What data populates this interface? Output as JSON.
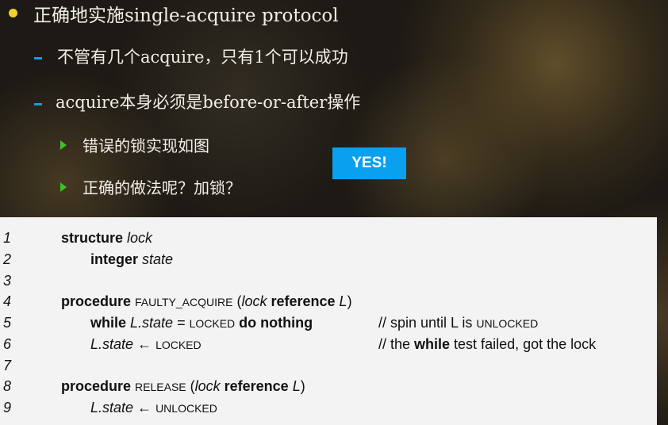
{
  "slide": {
    "bullets": [
      {
        "level": 1,
        "text": "正确地实施single-acquire protocol"
      },
      {
        "level": 2,
        "text": "不管有几个acquire，只有1个可以成功"
      },
      {
        "level": 2,
        "text": "acquire本身必须是before-or-after操作"
      },
      {
        "level": 3,
        "text": "错误的锁实现如图"
      },
      {
        "level": 3,
        "text": "正确的做法呢？加锁？"
      }
    ],
    "yes_label": "YES!",
    "colors": {
      "yes_bg": "#0aa0f0",
      "bullet_dot": "#f2d22a",
      "dash": "#1a9ae0",
      "triangle": "#3fc02a"
    }
  },
  "code": {
    "lines": [
      {
        "num": "1",
        "indent": 1,
        "code": [
          {
            "t": "structure ",
            "s": "b"
          },
          {
            "t": "lock",
            "s": "i"
          }
        ],
        "comment": []
      },
      {
        "num": "2",
        "indent": 2,
        "code": [
          {
            "t": "integer ",
            "s": "b"
          },
          {
            "t": "state",
            "s": "i"
          }
        ],
        "comment": []
      },
      {
        "num": "3",
        "indent": 1,
        "code": [],
        "comment": []
      },
      {
        "num": "4",
        "indent": 1,
        "code": [
          {
            "t": "procedure ",
            "s": "b"
          },
          {
            "t": "FAULTY_ACQUIRE",
            "s": "sc"
          },
          {
            "t": " (",
            "s": "n"
          },
          {
            "t": "lock",
            "s": "i"
          },
          {
            "t": " reference ",
            "s": "b"
          },
          {
            "t": "L",
            "s": "i"
          },
          {
            "t": ")",
            "s": "n"
          }
        ],
        "comment": []
      },
      {
        "num": "5",
        "indent": 2,
        "code": [
          {
            "t": "while ",
            "s": "b"
          },
          {
            "t": "L.state",
            "s": "i"
          },
          {
            "t": " = ",
            "s": "n"
          },
          {
            "t": "LOCKED",
            "s": "sc"
          },
          {
            "t": " do nothing",
            "s": "b"
          }
        ],
        "comment": [
          {
            "t": "// spin until L is ",
            "s": "n"
          },
          {
            "t": "UNLOCKED",
            "s": "sc"
          }
        ]
      },
      {
        "num": "6",
        "indent": 2,
        "code": [
          {
            "t": "L.state",
            "s": "i"
          },
          {
            "t": " ← ",
            "s": "n"
          },
          {
            "t": "LOCKED",
            "s": "sc"
          }
        ],
        "comment": [
          {
            "t": "// the ",
            "s": "n"
          },
          {
            "t": "while",
            "s": "b"
          },
          {
            "t": " test failed, got the lock",
            "s": "n"
          }
        ]
      },
      {
        "num": "7",
        "indent": 1,
        "code": [],
        "comment": []
      },
      {
        "num": "8",
        "indent": 1,
        "code": [
          {
            "t": "procedure ",
            "s": "b"
          },
          {
            "t": "RELEASE",
            "s": "sc"
          },
          {
            "t": " (",
            "s": "n"
          },
          {
            "t": "lock",
            "s": "i"
          },
          {
            "t": " reference ",
            "s": "b"
          },
          {
            "t": "L",
            "s": "i"
          },
          {
            "t": ")",
            "s": "n"
          }
        ],
        "comment": []
      },
      {
        "num": "9",
        "indent": 2,
        "code": [
          {
            "t": "L.state",
            "s": "i"
          },
          {
            "t": " ← ",
            "s": "n"
          },
          {
            "t": "UNLOCKED",
            "s": "sc"
          }
        ],
        "comment": []
      }
    ]
  }
}
